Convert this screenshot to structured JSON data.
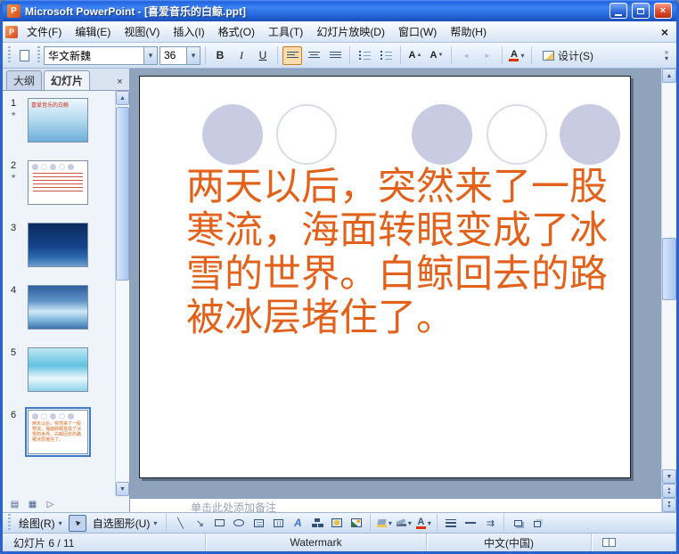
{
  "titlebar": {
    "title": "Microsoft PowerPoint - [喜爱音乐的白鲸.ppt]"
  },
  "menu": {
    "items": [
      "文件(F)",
      "编辑(E)",
      "视图(V)",
      "插入(I)",
      "格式(O)",
      "工具(T)",
      "幻灯片放映(D)",
      "窗口(W)",
      "帮助(H)"
    ]
  },
  "toolbar": {
    "font_name": "华文新魏",
    "font_size": "36",
    "bold": "B",
    "italic": "I",
    "underline": "U",
    "font_color_letter": "A",
    "design": "设计(S)"
  },
  "pane": {
    "tab_outline": "大纲",
    "tab_slides": "幻灯片",
    "slides": [
      {
        "num": "1",
        "title": "喜爱音乐的白鲸"
      },
      {
        "num": "2"
      },
      {
        "num": "3"
      },
      {
        "num": "4"
      },
      {
        "num": "5"
      },
      {
        "num": "6"
      }
    ]
  },
  "slide": {
    "lines": [
      "两天以后，突然来了一股",
      "寒流，海面转眼变成了冰",
      "雪的世界。白鲸回去的路",
      "被冰层堵住了。"
    ],
    "text": "两天以后，突然来了一股寒流，海面转眼变成了冰雪的世界。白鲸回去的路被冰层堵住了。",
    "text_color": "#E2611B",
    "circle_fill_color": "#C9CBE3"
  },
  "notes": {
    "placeholder": "单击此处添加备注"
  },
  "drawing": {
    "draw": "绘图(R)",
    "autoshapes": "自选图形(U)",
    "wordart_letter": "A"
  },
  "statusbar": {
    "slide_indicator": "幻灯片 6 / 11",
    "theme": "Watermark",
    "language": "中文(中国)"
  },
  "icons": {
    "dropdown": "▾",
    "close": "×",
    "scroll_up": "▲",
    "scroll_down": "▼",
    "star": "★",
    "line": "╲",
    "arrow": "↘",
    "pointer": "►",
    "marker_up": "▲",
    "marker_down": "▼",
    "indent_left": "◄",
    "indent_right": "►",
    "arrow_style": "⇉",
    "view_normal": "▤",
    "view_sorter": "▦",
    "view_show": "▷",
    "overflow": "»"
  }
}
